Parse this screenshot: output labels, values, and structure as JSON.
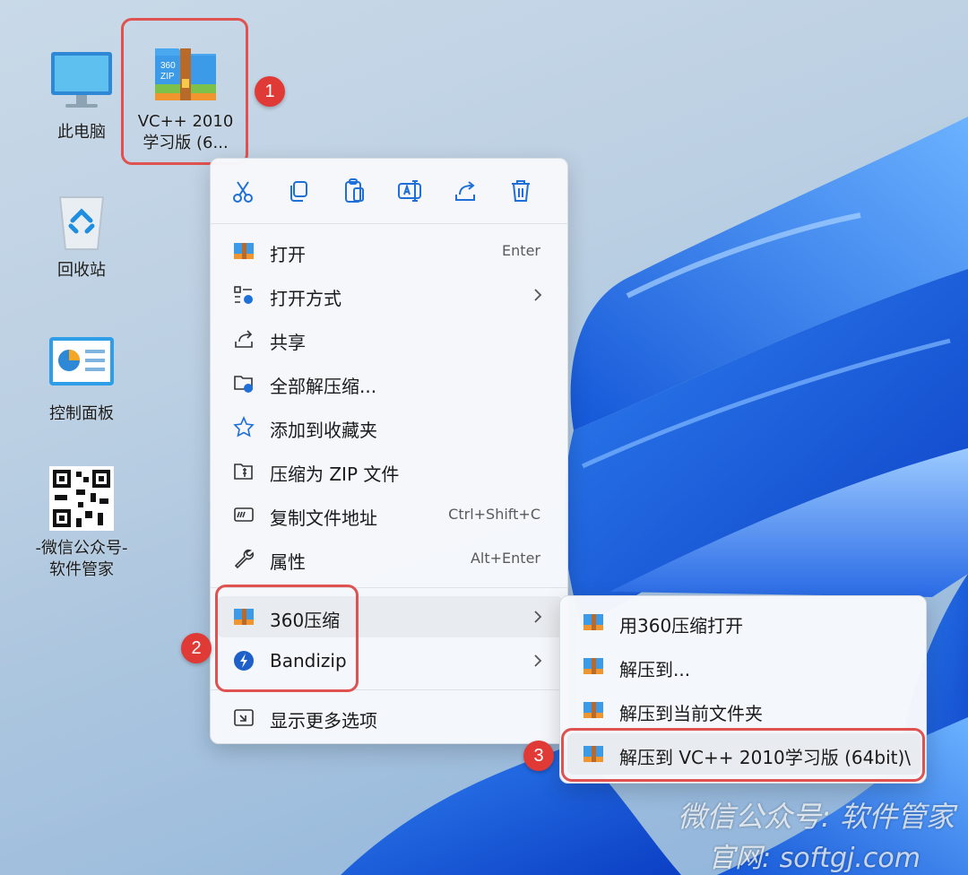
{
  "desktop": {
    "icons": [
      {
        "label": "此电脑"
      },
      {
        "label": "VC++ 2010\n学习版 (6..."
      },
      {
        "label": "回收站"
      },
      {
        "label": "控制面板"
      },
      {
        "label": "-微信公众号-\n软件管家"
      }
    ],
    "zip_icon_text": "360\nZIP"
  },
  "steps": [
    "1",
    "2",
    "3"
  ],
  "menu": {
    "toolbar": [
      "cut-icon",
      "copy-icon",
      "paste-icon",
      "rename-icon",
      "share-icon",
      "delete-icon"
    ],
    "items": [
      {
        "label": "打开",
        "shortcut": "Enter"
      },
      {
        "label": "打开方式"
      },
      {
        "label": "共享"
      },
      {
        "label": "全部解压缩..."
      },
      {
        "label": "添加到收藏夹"
      },
      {
        "label": "压缩为 ZIP 文件"
      },
      {
        "label": "复制文件地址",
        "shortcut": "Ctrl+Shift+C"
      },
      {
        "label": "属性",
        "shortcut": "Alt+Enter"
      },
      {
        "label": "360压缩"
      },
      {
        "label": "Bandizip"
      },
      {
        "label": "显示更多选项"
      }
    ]
  },
  "submenu": {
    "items": [
      {
        "label": "用360压缩打开"
      },
      {
        "label": "解压到..."
      },
      {
        "label": "解压到当前文件夹"
      },
      {
        "label": "解压到 VC++ 2010学习版 (64bit)\\"
      }
    ]
  },
  "watermark": {
    "line1": "微信公众号: 软件管家",
    "line2": "官网: softgj.com"
  },
  "colors": {
    "highlight": "#e0524f",
    "step_badge": "#e03a37",
    "accent_blue": "#1f6fd8"
  }
}
